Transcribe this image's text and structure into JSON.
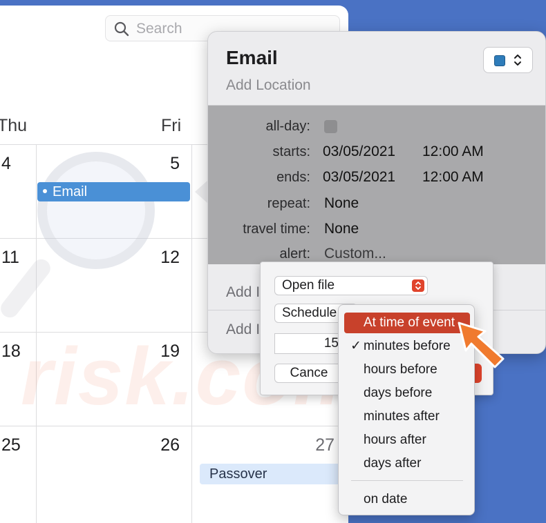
{
  "calendar": {
    "search_placeholder": "Search",
    "day_headers": [
      "Thu",
      "Fri"
    ],
    "rows": [
      {
        "thu": "4",
        "fri": "5"
      },
      {
        "thu": "11",
        "fri": "12"
      },
      {
        "thu": "18",
        "fri": "19"
      },
      {
        "thu": "25",
        "fri": "26",
        "sat": "27"
      }
    ],
    "events": {
      "email_chip": "Email",
      "passover_chip": "Passover"
    }
  },
  "watermark": {
    "text": "risk.com"
  },
  "popover": {
    "title": "Email",
    "location_placeholder": "Add Location",
    "calendar_color": "#2e7cba",
    "fields": {
      "allday_label": "all-day:",
      "starts_label": "starts:",
      "starts_date": "03/05/2021",
      "starts_time": "12:00 AM",
      "ends_label": "ends:",
      "ends_date": "03/05/2021",
      "ends_time": "12:00 AM",
      "repeat_label": "repeat:",
      "repeat_value": "None",
      "travel_label": "travel time:",
      "travel_value": "None",
      "alert_label": "alert:",
      "alert_value": "Custom..."
    },
    "add_invitees": "Add I",
    "add_notes": "Add I"
  },
  "alert_dialog": {
    "action_select": "Open file",
    "timing_select": "Schedule",
    "amount_value": "15",
    "cancel_label": "Cance"
  },
  "menu": {
    "items": [
      {
        "label": "At time of event",
        "selected": true,
        "checked": false
      },
      {
        "label": "minutes before",
        "selected": false,
        "checked": true
      },
      {
        "label": "hours before",
        "selected": false,
        "checked": false
      },
      {
        "label": "days before",
        "selected": false,
        "checked": false
      },
      {
        "label": "minutes after",
        "selected": false,
        "checked": false
      },
      {
        "label": "hours after",
        "selected": false,
        "checked": false
      },
      {
        "label": "days after",
        "selected": false,
        "checked": false
      },
      {
        "label": "on date",
        "selected": false,
        "checked": false
      }
    ],
    "check_glyph": "✓"
  },
  "colors": {
    "desktop": "#4a72c4",
    "event_blue": "#4a90d6",
    "menu_highlight": "#c8412b",
    "arrow_orange": "#f07a2e"
  }
}
